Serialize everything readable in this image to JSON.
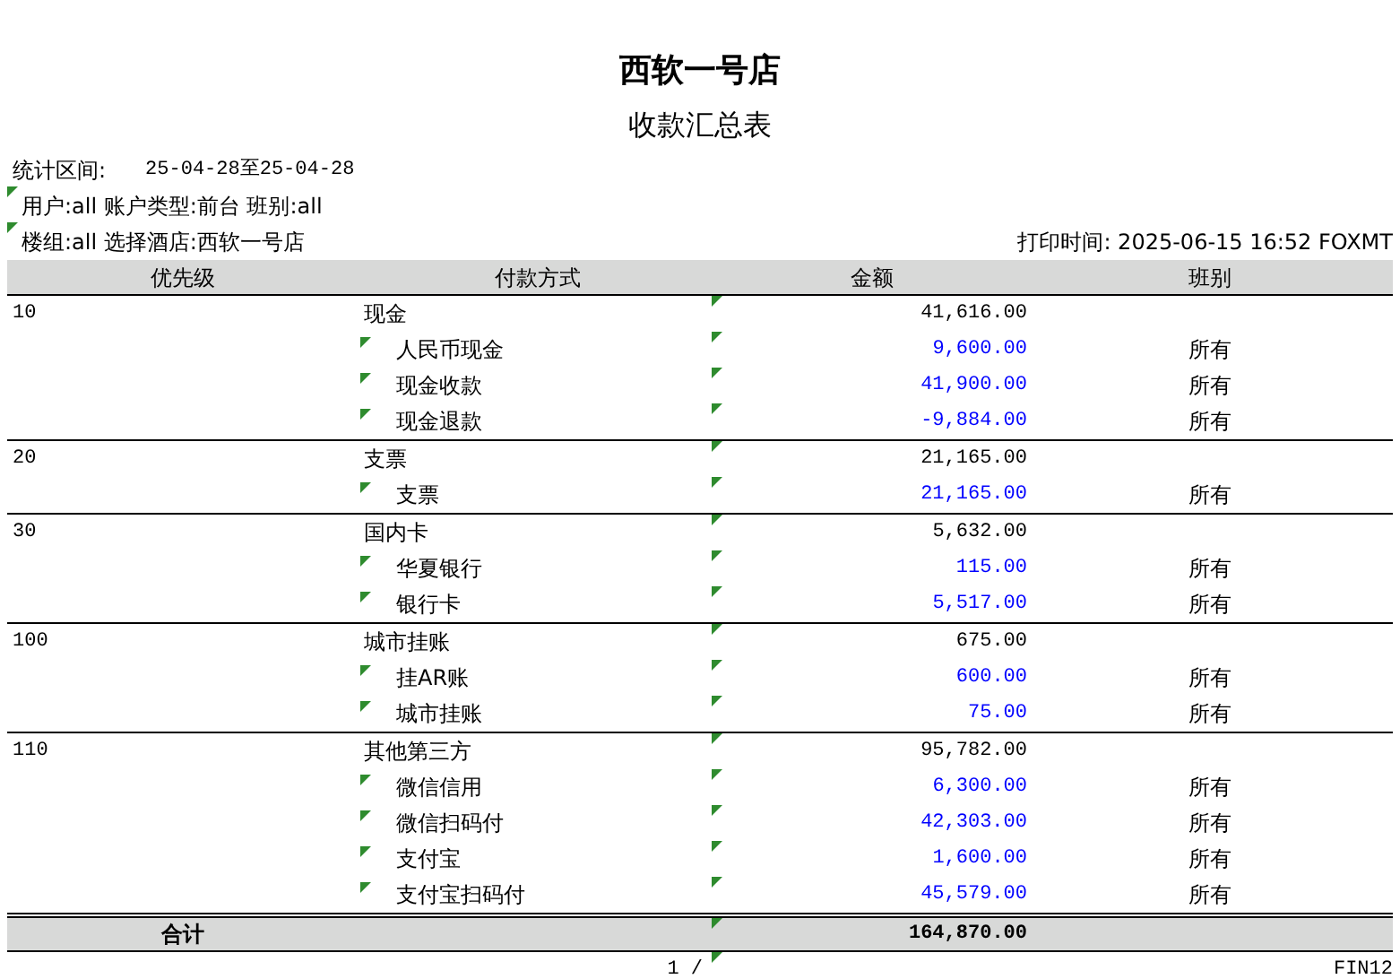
{
  "title": "西软一号店",
  "subtitle": "收款汇总表",
  "period": {
    "label": "统计区间:",
    "value": "25-04-28至25-04-28"
  },
  "filters": [
    "用户:all 账户类型:前台 班别:all",
    "楼组:all 选择酒店:西软一号店"
  ],
  "print_time": "打印时间: 2025-06-15 16:52 FOXMT",
  "columns": [
    "优先级",
    "付款方式",
    "金额",
    "班别"
  ],
  "groups": [
    {
      "priority": "10",
      "method": "现金",
      "amount": "41,616.00",
      "items": [
        {
          "method": "人民币现金",
          "amount": "9,600.00",
          "shift": "所有"
        },
        {
          "method": "现金收款",
          "amount": "41,900.00",
          "shift": "所有"
        },
        {
          "method": "现金退款",
          "amount": "-9,884.00",
          "shift": "所有"
        }
      ]
    },
    {
      "priority": "20",
      "method": "支票",
      "amount": "21,165.00",
      "items": [
        {
          "method": "支票",
          "amount": "21,165.00",
          "shift": "所有"
        }
      ]
    },
    {
      "priority": "30",
      "method": "国内卡",
      "amount": "5,632.00",
      "items": [
        {
          "method": "华夏银行",
          "amount": "115.00",
          "shift": "所有"
        },
        {
          "method": "银行卡",
          "amount": "5,517.00",
          "shift": "所有"
        }
      ]
    },
    {
      "priority": "100",
      "method": "城市挂账",
      "amount": "675.00",
      "items": [
        {
          "method": "挂AR账",
          "amount": "600.00",
          "shift": "所有"
        },
        {
          "method": "城市挂账",
          "amount": "75.00",
          "shift": "所有"
        }
      ]
    },
    {
      "priority": "110",
      "method": "其他第三方",
      "amount": "95,782.00",
      "items": [
        {
          "method": "微信信用",
          "amount": "6,300.00",
          "shift": "所有"
        },
        {
          "method": "微信扫码付",
          "amount": "42,303.00",
          "shift": "所有"
        },
        {
          "method": "支付宝",
          "amount": "1,600.00",
          "shift": "所有"
        },
        {
          "method": "支付宝扫码付",
          "amount": "45,579.00",
          "shift": "所有"
        }
      ]
    }
  ],
  "total": {
    "label": "合计",
    "amount": "164,870.00"
  },
  "footer": {
    "page": "1 /",
    "code": "FIN12"
  }
}
